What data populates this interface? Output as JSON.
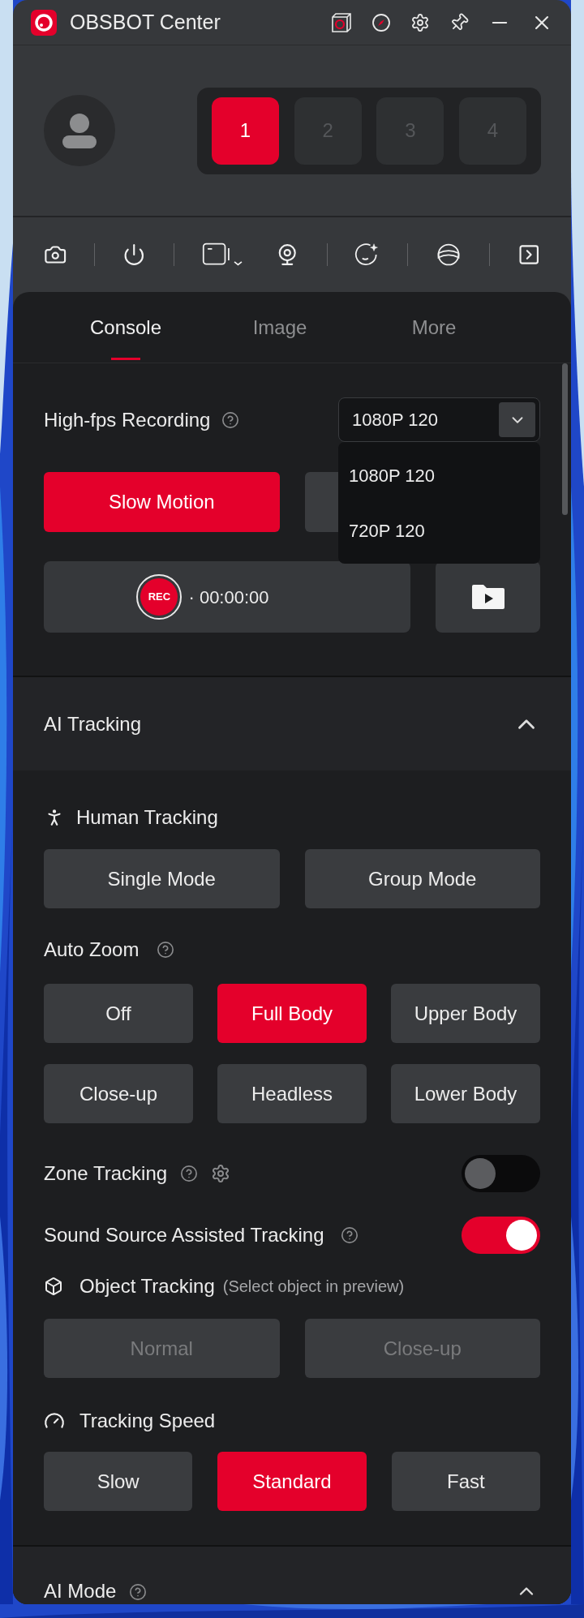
{
  "window": {
    "title": "OBSBOT Center"
  },
  "devices": [
    {
      "label": "1",
      "selected": true
    },
    {
      "label": "2",
      "selected": false
    },
    {
      "label": "3",
      "selected": false
    },
    {
      "label": "4",
      "selected": false
    }
  ],
  "tabs": [
    {
      "label": "Console",
      "selected": true
    },
    {
      "label": "Image",
      "selected": false
    },
    {
      "label": "More",
      "selected": false
    }
  ],
  "high_fps": {
    "label": "High-fps Recording",
    "value": "1080P 120",
    "expanded": true,
    "options": [
      "1080P 120",
      "720P 120"
    ]
  },
  "mode_buttons": [
    {
      "label": "Slow Motion",
      "selected": true
    },
    {
      "selected": false
    }
  ],
  "recording": {
    "badge": "REC",
    "time": "· 00:00:00"
  },
  "ai_tracking": {
    "title": "AI Tracking",
    "expanded": true,
    "human_tracking": {
      "label": "Human Tracking",
      "options": [
        {
          "label": "Single Mode",
          "selected": false
        },
        {
          "label": "Group Mode",
          "selected": false
        }
      ]
    },
    "auto_zoom": {
      "label": "Auto Zoom",
      "options": [
        {
          "label": "Off",
          "selected": false
        },
        {
          "label": "Full Body",
          "selected": true
        },
        {
          "label": "Upper Body",
          "selected": false
        },
        {
          "label": "Close-up",
          "selected": false
        },
        {
          "label": "Headless",
          "selected": false
        },
        {
          "label": "Lower Body",
          "selected": false
        }
      ]
    },
    "zone_tracking": {
      "label": "Zone Tracking",
      "on": false
    },
    "sound_source": {
      "label": "Sound Source Assisted Tracking",
      "on": true
    },
    "object_tracking": {
      "label": "Object Tracking",
      "hint": "(Select object in preview)",
      "options": [
        {
          "label": "Normal",
          "disabled": true
        },
        {
          "label": "Close-up",
          "disabled": true
        }
      ]
    },
    "tracking_speed": {
      "label": "Tracking Speed",
      "options": [
        {
          "label": "Slow",
          "selected": false
        },
        {
          "label": "Standard",
          "selected": true
        },
        {
          "label": "Fast",
          "selected": false
        }
      ]
    }
  },
  "ai_mode": {
    "title": "AI Mode",
    "expanded": true
  }
}
